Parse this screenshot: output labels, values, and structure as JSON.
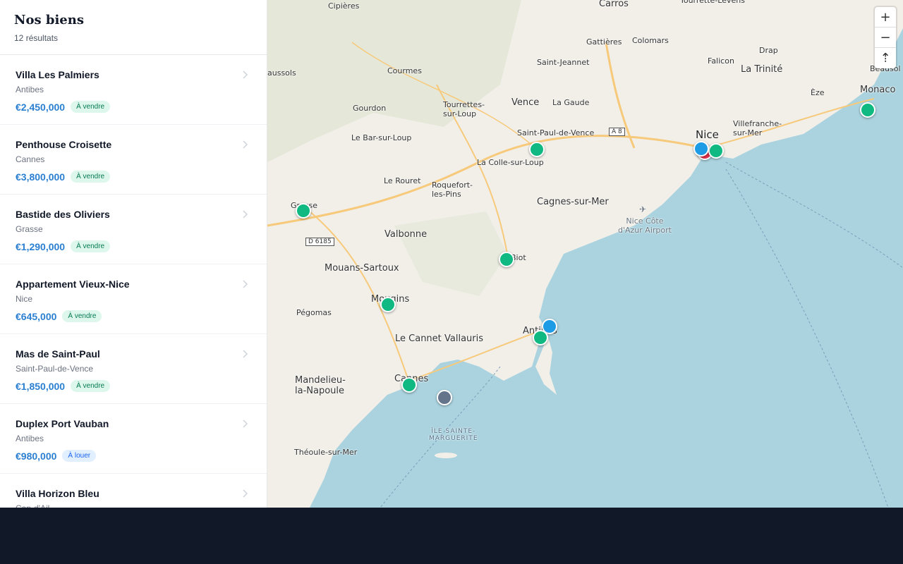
{
  "sidebar": {
    "title": "Nos biens",
    "count": "12",
    "count_label": "résultats",
    "items": [
      {
        "title": "Villa Les Palmiers",
        "city": "Antibes",
        "price": "€2,450,000",
        "badge": "À vendre",
        "type": "sale"
      },
      {
        "title": "Penthouse Croisette",
        "city": "Cannes",
        "price": "€3,800,000",
        "badge": "À vendre",
        "type": "sale"
      },
      {
        "title": "Bastide des Oliviers",
        "city": "Grasse",
        "price": "€1,290,000",
        "badge": "À vendre",
        "type": "sale"
      },
      {
        "title": "Appartement Vieux-Nice",
        "city": "Nice",
        "price": "€645,000",
        "badge": "À vendre",
        "type": "sale"
      },
      {
        "title": "Mas de Saint-Paul",
        "city": "Saint-Paul-de-Vence",
        "price": "€1,850,000",
        "badge": "À vendre",
        "type": "sale"
      },
      {
        "title": "Duplex Port Vauban",
        "city": "Antibes",
        "price": "€980,000",
        "badge": "À louer",
        "type": "rent"
      },
      {
        "title": "Villa Horizon Bleu",
        "city": "Cap-d'Ail",
        "price": "",
        "badge": "",
        "type": "sale"
      }
    ]
  },
  "map": {
    "labels": {
      "cipieres": "Cipières",
      "carros": "Carros",
      "tourrette": "Tourrette-Levens",
      "gattieres": "Gattières",
      "colomars": "Colomars",
      "saint_jeannet": "Saint-Jeannet",
      "drap": "Drap",
      "falicon": "Falicon",
      "la_trinite": "La Trinité",
      "beausoleil": "Beausol",
      "monaco": "Monaco",
      "eze": "Èze",
      "caussols": "aussols",
      "courmes": "Courmes",
      "gourdon": "Gourdon",
      "tourrettes_loup": "Tourrettes-\nsur-Loup",
      "vence": "Vence",
      "la_gaude": "La Gaude",
      "saint_paul": "Saint-Paul-de-Vence",
      "nice": "Nice",
      "villefranche": "Villefranche-\nsur-Mer",
      "le_bar": "Le Bar-sur-Loup",
      "la_colle": "La Colle-sur-Loup",
      "le_rouret": "Le Rouret",
      "roquefort": "Roquefort-\nles-Pins",
      "cagnes": "Cagnes-sur-Mer",
      "grasse": "Grasse",
      "valbonne": "Valbonne",
      "airport": "Nice Côte\nd'Azur Airport",
      "mouans": "Mouans-Sartoux",
      "biot": "Biot",
      "pegomas": "Pégomas",
      "mougins": "Mougins",
      "le_cannet": "Le Cannet",
      "vallauris": "Vallauris",
      "antibes": "Antibes",
      "mandelieu": "Mandelieu-\nla-Napoule",
      "cannes": "Cannes",
      "ile": "ÎLE SAINTE-\nMARGUERITE",
      "theoule": "Théoule-sur-Mer"
    },
    "shields": {
      "a8": "A 8",
      "d6185": "D 6185"
    },
    "marker_colors": {
      "sale": "#10b981",
      "rent": "#1e9be5",
      "sold": "#e0314b",
      "other": "#64748b"
    },
    "markers": [
      {
        "type": "sale",
        "name": "marker-monaco"
      },
      {
        "type": "sale",
        "name": "marker-saint-paul"
      },
      {
        "type": "sold",
        "name": "marker-nice-sold"
      },
      {
        "type": "sale",
        "name": "marker-nice-sale"
      },
      {
        "type": "rent",
        "name": "marker-nice-rent"
      },
      {
        "type": "sale",
        "name": "marker-grasse"
      },
      {
        "type": "sale",
        "name": "marker-biot"
      },
      {
        "type": "sale",
        "name": "marker-mougins"
      },
      {
        "type": "rent",
        "name": "marker-antibes-rent"
      },
      {
        "type": "sale",
        "name": "marker-antibes-sale"
      },
      {
        "type": "sale",
        "name": "marker-cannes"
      },
      {
        "type": "other",
        "name": "marker-cannes-other"
      }
    ],
    "controls": {
      "zoom_in": "+",
      "zoom_out": "−",
      "compass": "⇡"
    }
  }
}
